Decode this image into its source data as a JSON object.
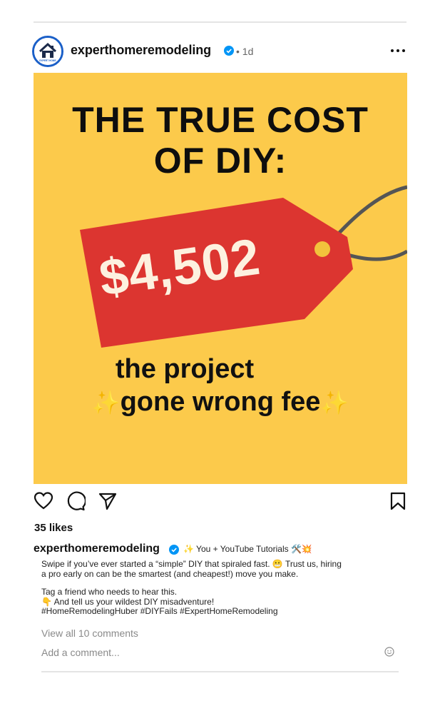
{
  "post": {
    "username": "experthomeremodeling",
    "time": "• 1d",
    "verified": true
  },
  "avatar": {
    "brand_text": "EXPERT HOME"
  },
  "image": {
    "headline_line1": "THE TRUE COST",
    "headline_line2": "OF DIY:",
    "price": "$4,502",
    "subline_line1": "the project",
    "subline_line2": "gone wrong fee",
    "sparkle": "✨",
    "colors": {
      "background": "#fcca4b",
      "tag": "#dc3530",
      "text": "#0e0e0e"
    }
  },
  "actions": {
    "like_icon": "heart-icon",
    "comment_icon": "comment-icon",
    "share_icon": "share-icon",
    "save_icon": "bookmark-icon"
  },
  "likes": "35 likes",
  "caption": {
    "username": "experthomeremodeling",
    "tagline": "✨  You + YouTube Tutorials 🛠️💥",
    "line1": "Swipe if you’ve ever started a “simple” DIY that spiraled fast. 😬  Trust us, hiring",
    "line2": "a pro early on can be the smartest (and cheapest!) move you make.",
    "line3": "Tag a friend who needs to hear this.",
    "line4": "👇   And tell us your wildest DIY misadventure!",
    "line5": "#HomeRemodelingHuber #DIYFails #ExpertHomeRemodeling"
  },
  "comments": {
    "view_all": "View all 10 comments",
    "placeholder": "Add a comment..."
  }
}
